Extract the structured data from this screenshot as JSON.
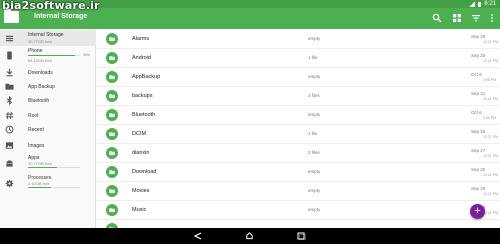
{
  "watermark": "bia2software.ir",
  "status": {
    "time": "6:21"
  },
  "toolbar": {
    "title": "Internal Storage"
  },
  "sidebar": {
    "storage": [
      {
        "id": "internal",
        "label": "Internal Storage",
        "sub": "30.77GB free",
        "icon": "phone-storage-icon",
        "active": true
      },
      {
        "id": "phone",
        "label": "Phone",
        "sub": "54.12GB free",
        "icon": "phone-icon",
        "percent_label": "90%",
        "usage": 0.9
      }
    ],
    "shortcuts": [
      {
        "id": "downloads",
        "label": "Downloads",
        "icon": "download-icon"
      },
      {
        "id": "app-backup",
        "label": "App Backup",
        "icon": "folder-icon"
      },
      {
        "id": "bluetooth",
        "label": "Bluetooth",
        "icon": "bluetooth-icon"
      },
      {
        "id": "root",
        "label": "Root",
        "icon": "hash-icon"
      },
      {
        "id": "recent",
        "label": "Recent",
        "icon": "clock-icon"
      },
      {
        "id": "images",
        "label": "Images",
        "icon": "image-icon"
      },
      {
        "id": "apps",
        "label": "Apps",
        "sub": "30.77GB free",
        "icon": "android-icon",
        "usage": 0.55
      },
      {
        "id": "processes",
        "label": "Processes",
        "sub": "2.10GB free",
        "icon": "gear-icon",
        "usage": 0.45
      }
    ]
  },
  "files": [
    {
      "name": "Alarms",
      "size": "empty",
      "date": "Sep 20",
      "time": "12:21 PM"
    },
    {
      "name": "Android",
      "size": "1 file",
      "date": "Sep 20",
      "time": "12:21 PM"
    },
    {
      "name": "AppBackup",
      "size": "empty",
      "date": "Oct 6",
      "time": "2:55 PM"
    },
    {
      "name": "backups",
      "size": "3 files",
      "date": "Sep 21",
      "time": "12:21 PM"
    },
    {
      "name": "Bluetooth",
      "size": "empty",
      "date": "Oct 6",
      "time": "2:55 PM"
    },
    {
      "name": "DCIM",
      "size": "1 file",
      "date": "Sep 20",
      "time": "12:21 PM"
    },
    {
      "name": "dianxin",
      "size": "2 files",
      "date": "Sep 27",
      "time": "12:21 PM"
    },
    {
      "name": "Download",
      "size": "empty",
      "date": "Sep 20",
      "time": "12:21 PM"
    },
    {
      "name": "Movies",
      "size": "empty",
      "date": "Sep 20",
      "time": "12:21 PM"
    },
    {
      "name": "Music",
      "size": "empty",
      "date": "Sep 20",
      "time": "12:21 PM"
    },
    {
      "name": "",
      "size": "",
      "date": "",
      "time": ""
    }
  ],
  "colors": {
    "primary": "#4caf50",
    "status": "#43a047",
    "accent": "#7b1fa2"
  }
}
